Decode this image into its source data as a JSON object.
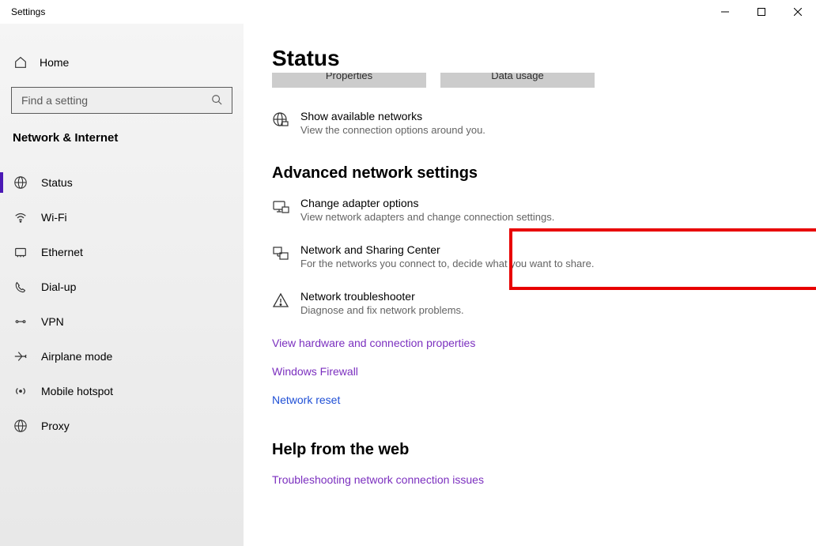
{
  "window": {
    "title": "Settings"
  },
  "sidebar": {
    "home": "Home",
    "search_placeholder": "Find a setting",
    "section": "Network & Internet",
    "items": [
      {
        "label": "Status",
        "active": true
      },
      {
        "label": "Wi-Fi",
        "active": false
      },
      {
        "label": "Ethernet",
        "active": false
      },
      {
        "label": "Dial-up",
        "active": false
      },
      {
        "label": "VPN",
        "active": false
      },
      {
        "label": "Airplane mode",
        "active": false
      },
      {
        "label": "Mobile hotspot",
        "active": false
      },
      {
        "label": "Proxy",
        "active": false
      }
    ]
  },
  "main": {
    "heading": "Status",
    "buttons": {
      "properties": "Properties",
      "data_usage": "Data usage"
    },
    "available": {
      "title": "Show available networks",
      "desc": "View the connection options around you."
    },
    "advanced_heading": "Advanced network settings",
    "adapter": {
      "title": "Change adapter options",
      "desc": "View network adapters and change connection settings."
    },
    "sharing": {
      "title": "Network and Sharing Center",
      "desc": "For the networks you connect to, decide what you want to share."
    },
    "troubleshooter": {
      "title": "Network troubleshooter",
      "desc": "Diagnose and fix network problems."
    },
    "links": {
      "hardware": "View hardware and connection properties",
      "firewall": "Windows Firewall",
      "reset": "Network reset"
    },
    "help_heading": "Help from the web",
    "help_link": "Troubleshooting network connection issues"
  }
}
